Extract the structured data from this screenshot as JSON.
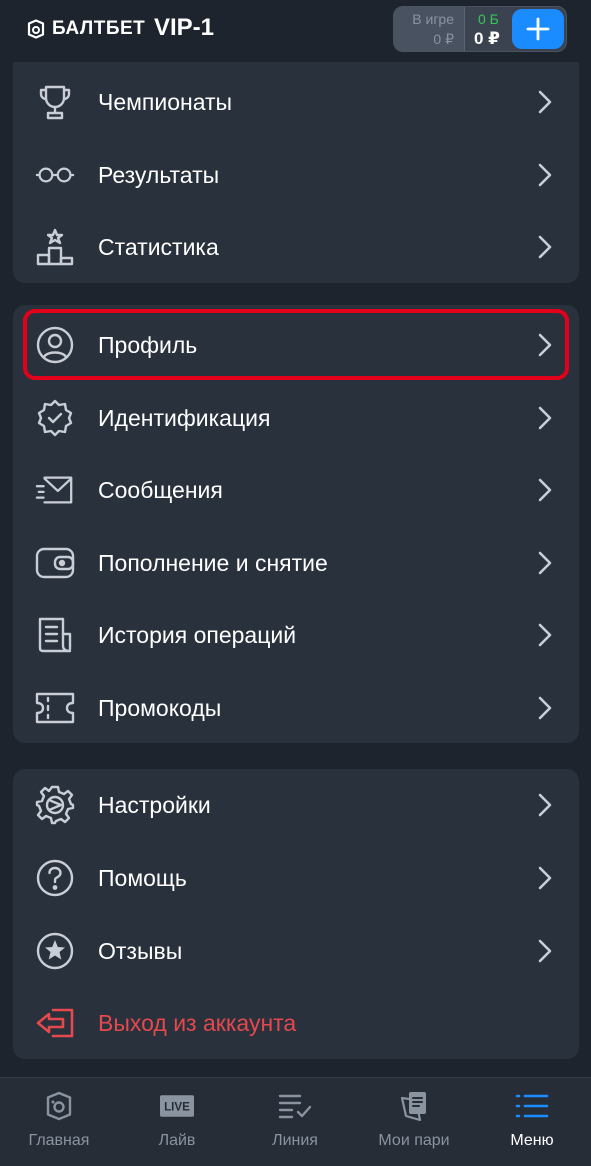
{
  "header": {
    "brand": "БАЛТБЕТ",
    "vip": "VIP-1",
    "balance": {
      "in_game_label": "В игре",
      "in_game_value": "0 ₽",
      "bonus": "0 Б",
      "money": "0 ₽"
    },
    "plus_icon": "plus-icon"
  },
  "menu": {
    "group1": [
      {
        "label": "Чемпионаты",
        "icon": "trophy-icon"
      },
      {
        "label": "Результаты",
        "icon": "glasses-icon"
      },
      {
        "label": "Статистика",
        "icon": "podium-icon"
      }
    ],
    "group2": [
      {
        "label": "Профиль",
        "icon": "user-icon"
      },
      {
        "label": "Идентификация",
        "icon": "verified-badge-icon"
      },
      {
        "label": "Сообщения",
        "icon": "envelope-icon"
      },
      {
        "label": "Пополнение и снятие",
        "icon": "wallet-icon"
      },
      {
        "label": "История операций",
        "icon": "receipt-icon"
      },
      {
        "label": "Промокоды",
        "icon": "ticket-icon"
      }
    ],
    "group3": [
      {
        "label": "Настройки",
        "icon": "gear-icon"
      },
      {
        "label": "Помощь",
        "icon": "help-icon"
      },
      {
        "label": "Отзывы",
        "icon": "star-icon"
      },
      {
        "label": "Выход из аккаунта",
        "icon": "logout-icon"
      }
    ]
  },
  "bottom_nav": [
    {
      "label": "Главная",
      "icon": "home-icon"
    },
    {
      "label": "Лайв",
      "icon": "live-icon",
      "badge": "LIVE"
    },
    {
      "label": "Линия",
      "icon": "line-icon"
    },
    {
      "label": "Мои пари",
      "icon": "bets-icon"
    },
    {
      "label": "Меню",
      "icon": "menu-icon",
      "active": true
    }
  ],
  "colors": {
    "accent": "#1a8cff",
    "danger": "#e5484d",
    "highlight": "#e3001b",
    "bonus": "#34c759",
    "card": "#29313c",
    "background": "#1e242d"
  }
}
